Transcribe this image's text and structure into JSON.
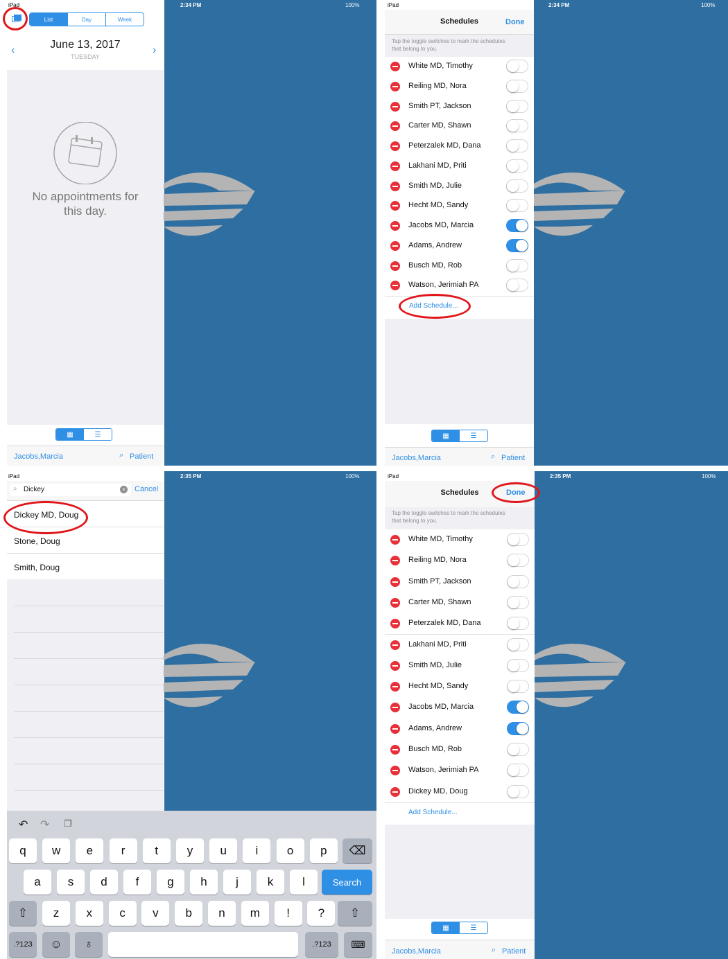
{
  "q1": {
    "status": {
      "carrier": "iPad",
      "time": "2:34 PM",
      "battery": "100%"
    },
    "segments": [
      "List",
      "Day",
      "Week"
    ],
    "date": "June 13, 2017",
    "weekday": "TUESDAY",
    "empty_message_line1": "No appointments for",
    "empty_message_line2": "this day.",
    "bottom_user": "Jacobs,Marcia",
    "bottom_patient": "Patient"
  },
  "q2": {
    "status": {
      "carrier": "iPad",
      "time": "2:34 PM",
      "battery": "100%"
    },
    "title": "Schedules",
    "done": "Done",
    "hint": "Tap the toggle switches to mark the schedules that belong to you.",
    "rows": [
      {
        "name": "White MD, Timothy",
        "on": false
      },
      {
        "name": "Reiling MD, Nora",
        "on": false
      },
      {
        "name": "Smith PT, Jackson",
        "on": false
      },
      {
        "name": "Carter MD, Shawn",
        "on": false
      },
      {
        "name": "Peterzalek MD, Dana",
        "on": false
      },
      {
        "name": "Lakhani MD, Priti",
        "on": false
      },
      {
        "name": "Smith MD, Julie",
        "on": false
      },
      {
        "name": "Hecht MD, Sandy",
        "on": false
      },
      {
        "name": "Jacobs MD, Marcia",
        "on": true
      },
      {
        "name": "Adams, Andrew",
        "on": true
      },
      {
        "name": "Busch MD, Rob",
        "on": false
      },
      {
        "name": "Watson, Jerimiah PA",
        "on": false
      }
    ],
    "add_schedule": "Add Schedule...",
    "bottom_user": "Jacobs,Marcia",
    "bottom_patient": "Patient"
  },
  "q3": {
    "status": {
      "carrier": "iPad",
      "time": "2:35 PM",
      "battery": "100%"
    },
    "search_value": "Dickey",
    "cancel": "Cancel",
    "results": [
      "Dickey MD, Doug",
      "Stone, Doug",
      "Smith, Doug"
    ],
    "keyboard": {
      "row1": [
        "q",
        "w",
        "e",
        "r",
        "t",
        "y",
        "u",
        "i",
        "o",
        "p"
      ],
      "row2": [
        "a",
        "s",
        "d",
        "f",
        "g",
        "h",
        "j",
        "k",
        "l"
      ],
      "row3": [
        "z",
        "x",
        "c",
        "v",
        "b",
        "n",
        "m",
        "!",
        "?"
      ],
      "search": "Search",
      "numbers": ".?123"
    }
  },
  "q4": {
    "status": {
      "carrier": "iPad",
      "time": "2:35 PM",
      "battery": "100%"
    },
    "title": "Schedules",
    "done": "Done",
    "hint": "Tap the toggle switches to mark the schedules that belong to you.",
    "rows": [
      {
        "name": "White MD, Timothy",
        "on": false
      },
      {
        "name": "Reiling MD, Nora",
        "on": false
      },
      {
        "name": "Smith PT, Jackson",
        "on": false
      },
      {
        "name": "Carter MD, Shawn",
        "on": false
      },
      {
        "name": "Peterzalek MD, Dana",
        "on": false
      },
      {
        "name": "Lakhani MD, Priti",
        "on": false
      },
      {
        "name": "Smith MD, Julie",
        "on": false
      },
      {
        "name": "Hecht MD, Sandy",
        "on": false
      },
      {
        "name": "Jacobs MD, Marcia",
        "on": true
      },
      {
        "name": "Adams, Andrew",
        "on": true
      },
      {
        "name": "Busch MD, Rob",
        "on": false
      },
      {
        "name": "Watson, Jerimiah PA",
        "on": false
      },
      {
        "name": "Dickey MD, Doug",
        "on": false
      }
    ],
    "add_schedule": "Add Schedule...",
    "bottom_user": "Jacobs,Marcia",
    "bottom_patient": "Patient"
  },
  "colors": {
    "accent": "#2f8fe5",
    "background_blue": "#2e6ea0",
    "highlight": "#e0161b",
    "delete_red": "#e8303a"
  }
}
